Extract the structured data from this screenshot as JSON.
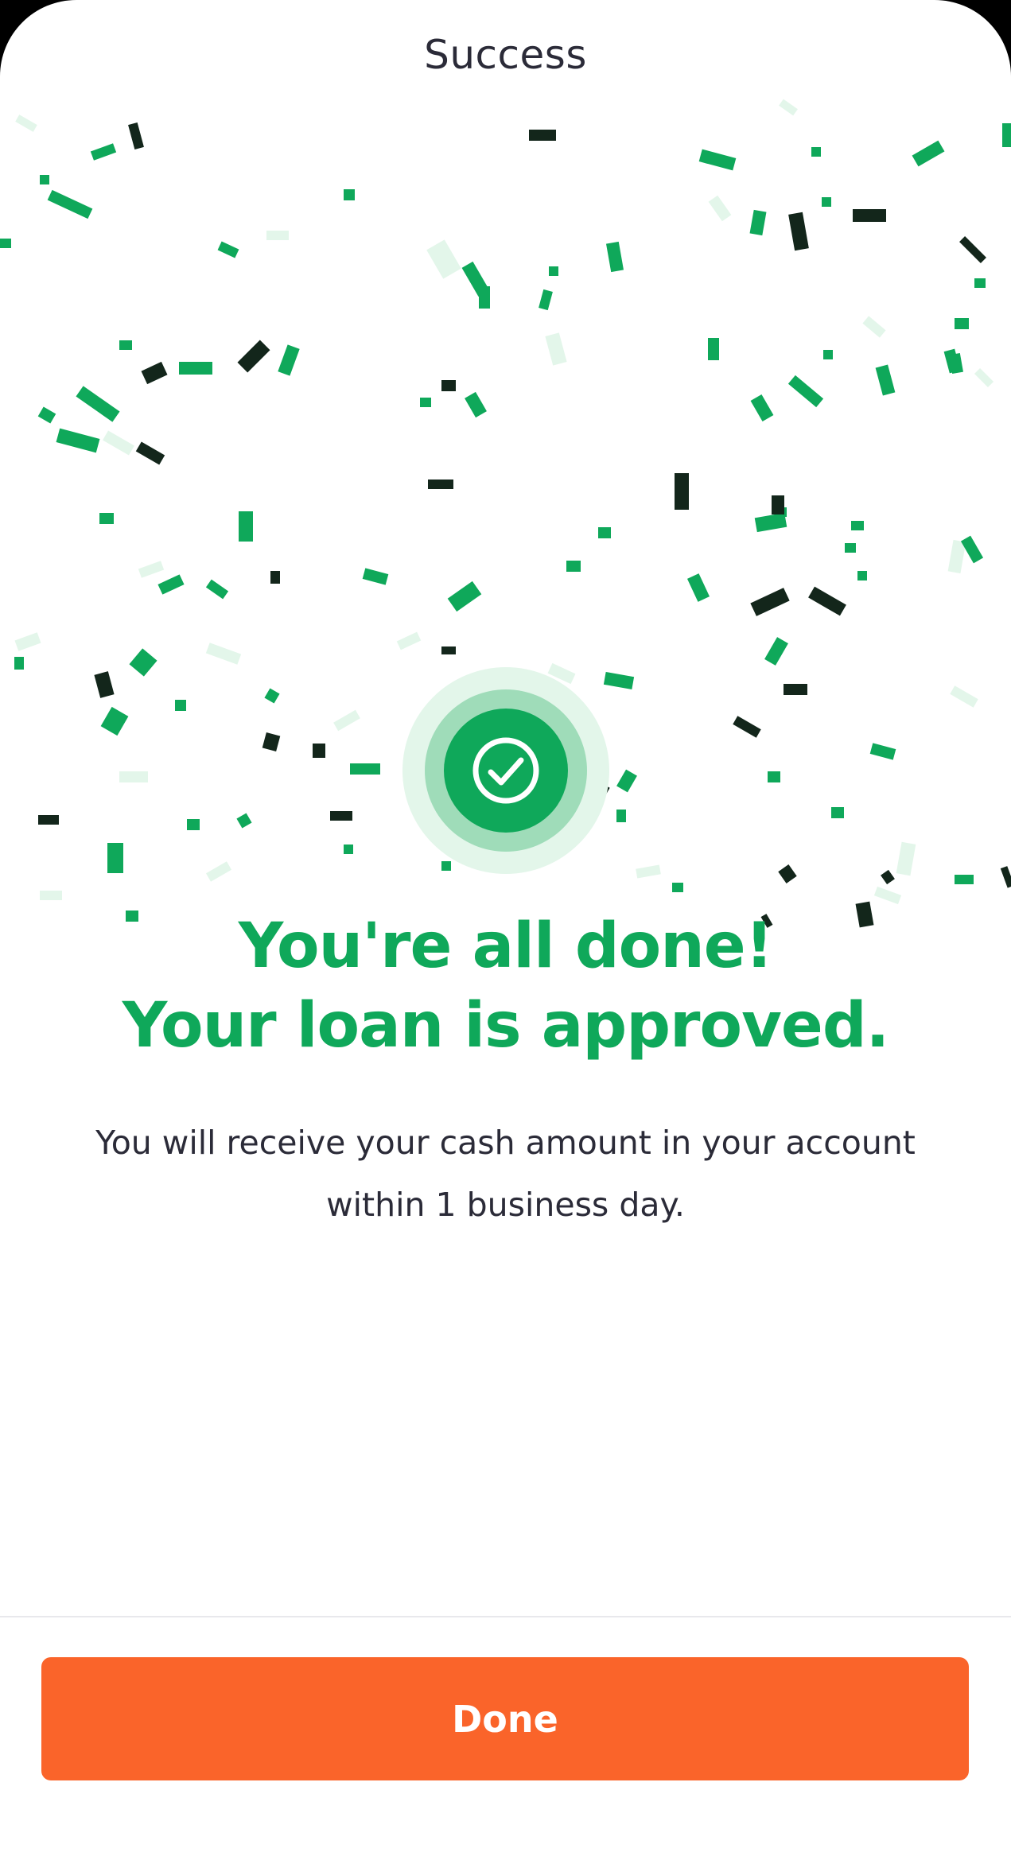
{
  "header": {
    "title": "Success"
  },
  "badge": {
    "icon": "check-circle-icon"
  },
  "message": {
    "headline_line1": "You're all done!",
    "headline_line2": "Your loan is approved.",
    "body": "You will receive your cash amount in your account within 1 business day."
  },
  "footer": {
    "done_label": "Done"
  },
  "colors": {
    "accent_green": "#0fa85a",
    "dark_confetti": "#13261b",
    "light_confetti": "#e3f6ea",
    "button_orange": "#fa642a",
    "text_dark": "#2b2b38"
  }
}
